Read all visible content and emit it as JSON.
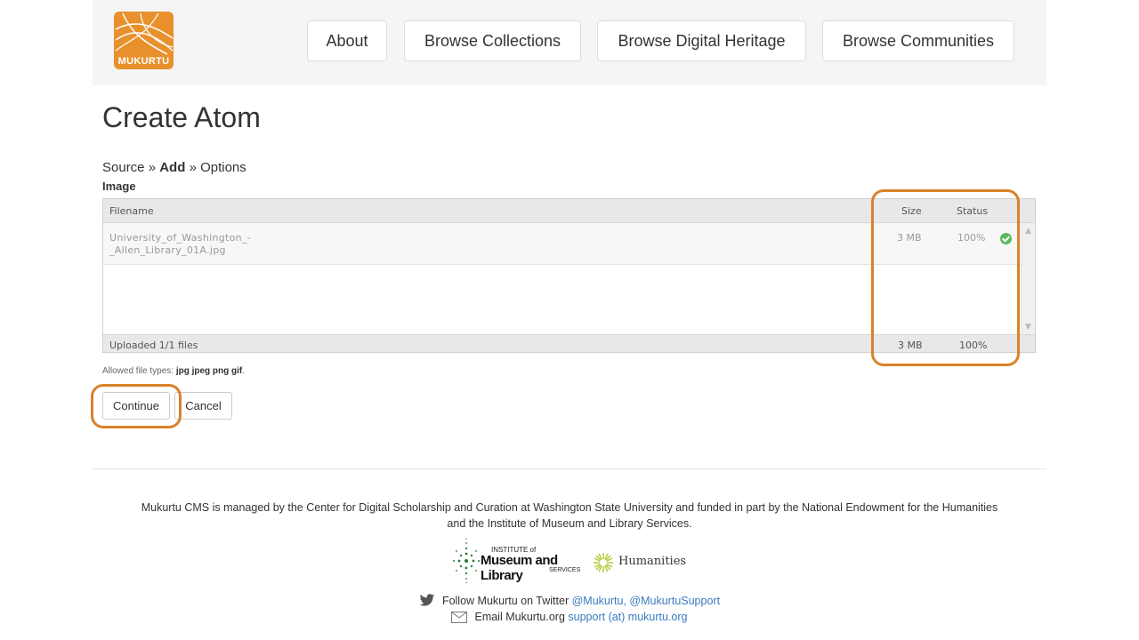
{
  "header": {
    "logo_text": "MUKURTU",
    "nav": [
      "About",
      "Browse Collections",
      "Browse Digital Heritage",
      "Browse Communities"
    ]
  },
  "page": {
    "title": "Create Atom",
    "breadcrumb": {
      "step1": "Source",
      "sep": "»",
      "step2": "Add",
      "step3": "Options"
    },
    "section_label": "Image"
  },
  "uploader": {
    "columns": {
      "filename": "Filename",
      "size": "Size",
      "status": "Status"
    },
    "files": [
      {
        "name_line1": "University_of_Washington_-",
        "name_line2": "_Allen_Library_01A.jpg",
        "size": "3 MB",
        "status": "100%"
      }
    ],
    "footer": {
      "summary": "Uploaded 1/1 files",
      "size": "3 MB",
      "status": "100%"
    }
  },
  "allowed": {
    "label": "Allowed file types:",
    "types": "jpg jpeg png gif",
    "end": "."
  },
  "actions": {
    "continue": "Continue",
    "cancel": "Cancel"
  },
  "footer": {
    "line1": "Mukurtu CMS is managed by the Center for Digital Scholarship and Curation at Washington State University and funded in part by the National Endowment for the Humanities",
    "line2": "and the Institute of Museum and Library Services.",
    "imls": {
      "top": "INSTITUTE of",
      "main": "Museum and Library",
      "bottom": "SERVICES"
    },
    "neh": "Humanities",
    "twitter_text": "Follow Mukurtu on Twitter",
    "twitter_link1": "@Mukurtu,",
    "twitter_link2": "@MukurtuSupport",
    "email_text": "Email Mukurtu.org",
    "email_link": "support (at) mukurtu.org"
  },
  "colors": {
    "brand": "#e8912c",
    "highlight": "#d9822b",
    "link": "#3a7abf",
    "success": "#5cb85c"
  }
}
